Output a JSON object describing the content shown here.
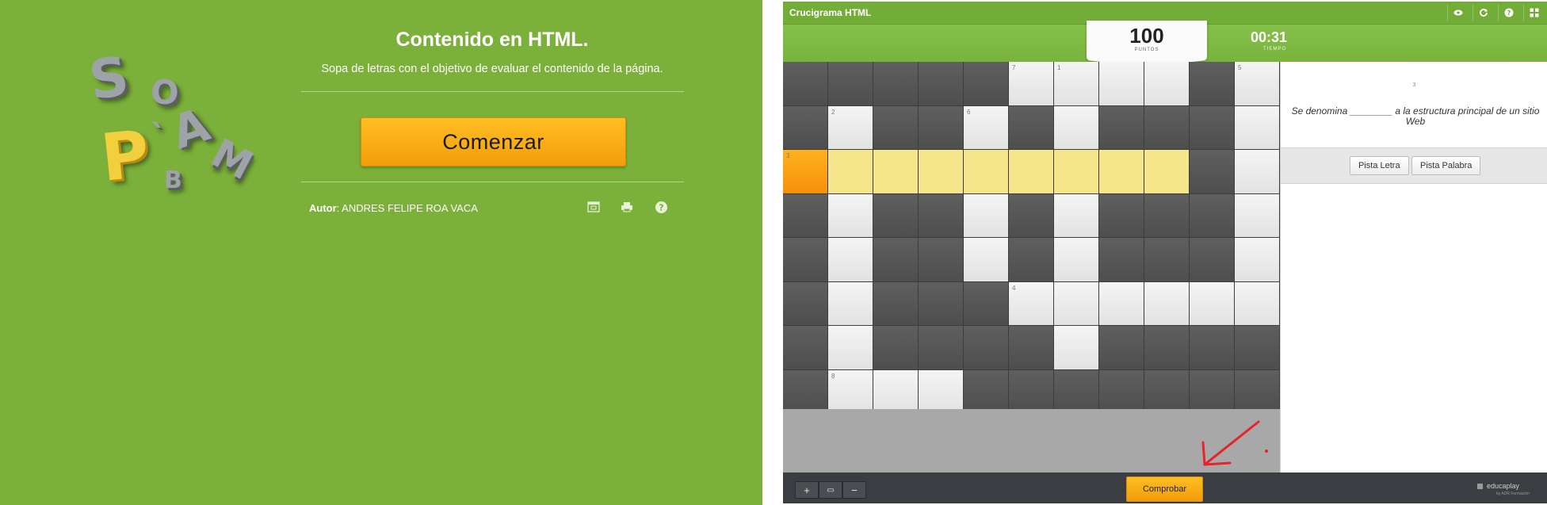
{
  "left": {
    "logo_letters": [
      "S",
      "O",
      "A",
      "M",
      "P",
      "B",
      "`"
    ],
    "title": "Contenido en HTML.",
    "subtitle": "Sopa de letras con el objetivo de evaluar el contenido de la página.",
    "start_button": "Comenzar",
    "author_label": "Autor",
    "author_name": ": ANDRES FELIPE ROA VACA",
    "icons": [
      "fullscreen-icon",
      "print-icon",
      "help-icon"
    ]
  },
  "right": {
    "app_title": "Crucigrama HTML",
    "top_icons": [
      "eye-icon",
      "refresh-icon",
      "help-icon",
      "grid-icon"
    ],
    "points_value": "100",
    "points_label": "PUNTOS",
    "time_value": "00:31",
    "time_label": "TIEMPO",
    "grid": [
      [
        "d",
        "d",
        "d",
        "d",
        "d",
        "l:7",
        "l:1",
        "l",
        "l",
        "d",
        "l:5"
      ],
      [
        "d",
        "l:2",
        "d",
        "d",
        "l:6",
        "d",
        "l",
        "d",
        "d",
        "d",
        "l"
      ],
      [
        "a:3",
        "h",
        "h",
        "h",
        "h",
        "h",
        "h",
        "h",
        "h",
        "d",
        "l"
      ],
      [
        "d",
        "l",
        "d",
        "d",
        "l",
        "d",
        "l",
        "d",
        "d",
        "d",
        "l"
      ],
      [
        "d",
        "l",
        "d",
        "d",
        "l",
        "d",
        "l",
        "d",
        "d",
        "d",
        "l"
      ],
      [
        "d",
        "l",
        "d",
        "d",
        "d",
        "l:4",
        "l",
        "l",
        "l",
        "l",
        "l"
      ],
      [
        "d",
        "l",
        "d",
        "d",
        "d",
        "d",
        "l",
        "d",
        "d",
        "d",
        "d"
      ],
      [
        "d",
        "l:8",
        "l",
        "l",
        "d",
        "d",
        "d",
        "d",
        "d",
        "d",
        "d"
      ]
    ],
    "clue_number": "3",
    "clue_text": "Se denomina ________ a la estructura principal de un sitio Web",
    "hint_letter": "Pista Letra",
    "hint_word": "Pista Palabra",
    "zoom": [
      "+",
      "▭",
      "−"
    ],
    "check_button": "Comprobar",
    "brand": "educaplay",
    "brand_sub": "by ADR Formación",
    "accent": "#f5a10f",
    "arrow_color": "#e8232a"
  }
}
